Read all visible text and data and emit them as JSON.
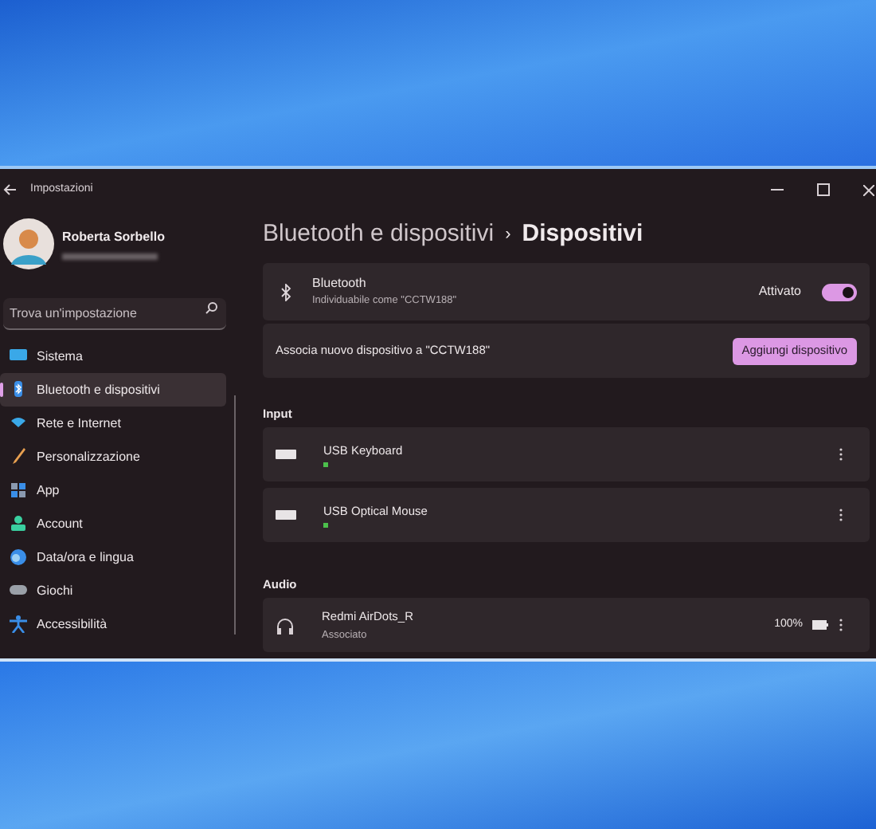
{
  "window": {
    "title": "Impostazioni"
  },
  "profile": {
    "name": "Roberta Sorbello"
  },
  "search": {
    "placeholder": "Trova un'impostazione"
  },
  "sidebar": {
    "items": [
      {
        "label": "Sistema",
        "selected": false
      },
      {
        "label": "Bluetooth e dispositivi",
        "selected": true
      },
      {
        "label": "Rete e Internet",
        "selected": false
      },
      {
        "label": "Personalizzazione",
        "selected": false
      },
      {
        "label": "App",
        "selected": false
      },
      {
        "label": "Account",
        "selected": false
      },
      {
        "label": "Data/ora e lingua",
        "selected": false
      },
      {
        "label": "Giochi",
        "selected": false
      },
      {
        "label": "Accessibilità",
        "selected": false
      }
    ]
  },
  "breadcrumb": {
    "parent": "Bluetooth e dispositivi",
    "separator": "›",
    "current": "Dispositivi"
  },
  "bluetooth": {
    "title": "Bluetooth",
    "subtitle": "Individuabile come \"CCTW188\"",
    "state_label": "Attivato",
    "on": true
  },
  "pair": {
    "label": "Associa nuovo dispositivo a \"CCTW188\"",
    "button": "Aggiungi dispositivo"
  },
  "sections": [
    {
      "title": "Input",
      "devices": [
        {
          "kind": "keyboard",
          "name": "USB Keyboard",
          "connected": true
        },
        {
          "kind": "keyboard",
          "name": "USB Optical Mouse",
          "connected": true
        }
      ]
    },
    {
      "title": "Audio",
      "devices": [
        {
          "kind": "headphones",
          "name": "Redmi AirDots_R",
          "status": "Associato",
          "connected": false,
          "battery": "100%"
        }
      ]
    }
  ]
}
